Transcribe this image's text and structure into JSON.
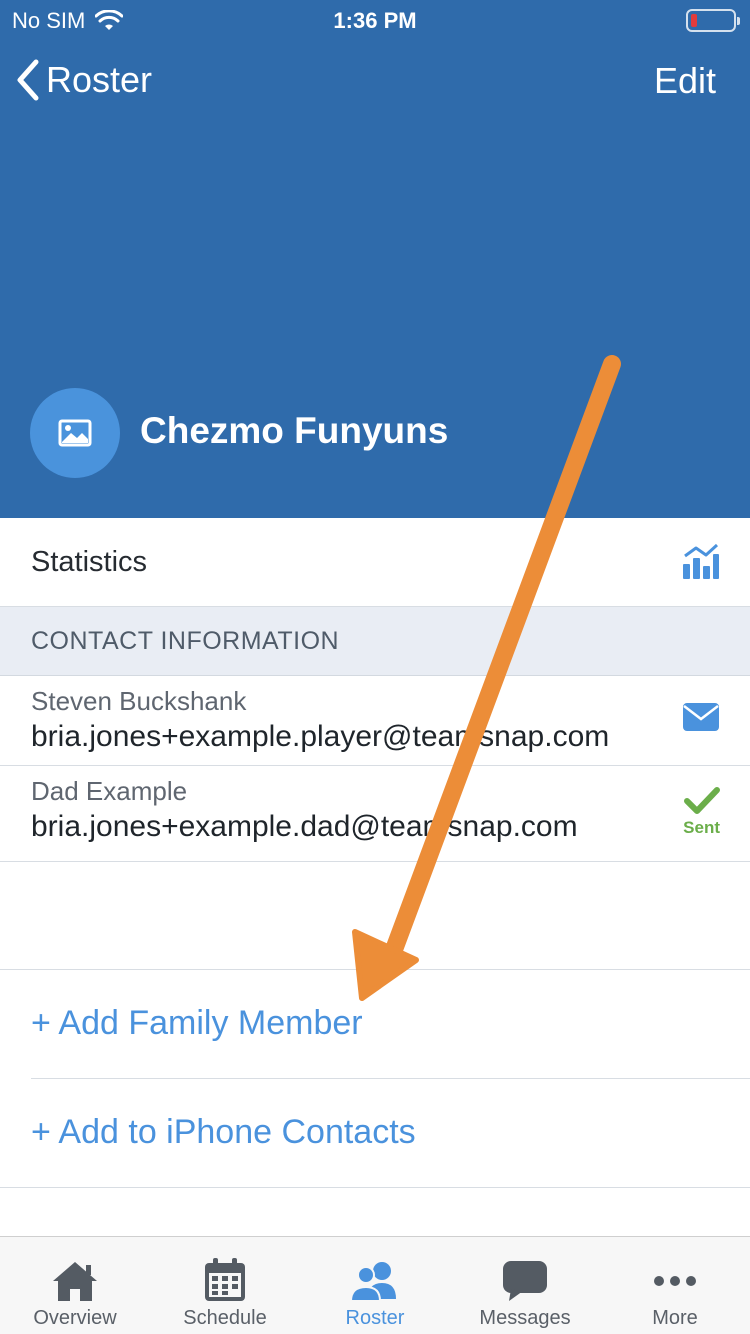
{
  "status_bar": {
    "carrier": "No SIM",
    "time": "1:36 PM"
  },
  "nav": {
    "back_label": "Roster",
    "edit_label": "Edit"
  },
  "team": {
    "name": "Chezmo Funyuns"
  },
  "statistics": {
    "label": "Statistics"
  },
  "contact_section": {
    "title": "CONTACT INFORMATION"
  },
  "contacts": [
    {
      "name": "Steven Buckshank",
      "email": "bria.jones+example.player@teamsnap.com",
      "action_icon": "envelope-icon"
    },
    {
      "name": "Dad Example",
      "email": "bria.jones+example.dad@teamsnap.com",
      "action_icon": "checkmark-icon",
      "status": "Sent"
    }
  ],
  "actions": {
    "add_family": "+ Add Family Member",
    "add_contacts": "+ Add to iPhone Contacts"
  },
  "tabs": [
    {
      "label": "Overview",
      "icon": "house-icon"
    },
    {
      "label": "Schedule",
      "icon": "calendar-icon"
    },
    {
      "label": "Roster",
      "icon": "people-icon",
      "active": true
    },
    {
      "label": "Messages",
      "icon": "chat-bubble-icon"
    },
    {
      "label": "More",
      "icon": "ellipsis-icon"
    }
  ],
  "colors": {
    "header": "#2f6bab",
    "accent": "#4a92dd",
    "sent": "#6bae4a",
    "annotation_arrow": "#ec8d38"
  }
}
